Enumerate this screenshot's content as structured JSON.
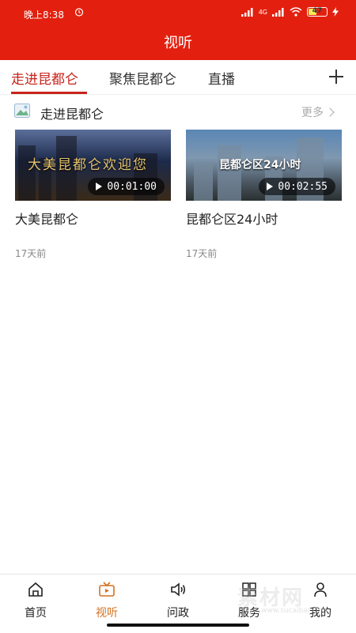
{
  "status_bar": {
    "time": "晚上8:38",
    "battery_level": "47",
    "network": "4G"
  },
  "header": {
    "title": "视听"
  },
  "tabs": [
    {
      "label": "走进昆都仑",
      "active": true
    },
    {
      "label": "聚焦昆都仑",
      "active": false
    },
    {
      "label": "直播",
      "active": false
    }
  ],
  "section": {
    "title": "走进昆都仑",
    "more_label": "更多"
  },
  "videos": [
    {
      "title": "大美昆都仑",
      "duration": "00:01:00",
      "overlay_text": "大美昆都仑欢迎您",
      "age": "17天前"
    },
    {
      "title": "昆都仑区24小时",
      "duration": "00:02:55",
      "overlay_text": "昆都仑区24小时",
      "age": "17天前"
    }
  ],
  "bottom_nav": [
    {
      "label": "首页",
      "icon": "home-icon",
      "active": false
    },
    {
      "label": "视听",
      "icon": "tv-icon",
      "active": true
    },
    {
      "label": "问政",
      "icon": "speaker-icon",
      "active": false
    },
    {
      "label": "服务",
      "icon": "grid-icon",
      "active": false
    },
    {
      "label": "我的",
      "icon": "user-icon",
      "active": false
    }
  ],
  "watermark": {
    "logo_text": "素材网",
    "url": "www.sucaibar.com"
  },
  "colors": {
    "brand_red": "#e3200f",
    "tab_active": "#c7241c",
    "nav_active": "#d3701f"
  }
}
